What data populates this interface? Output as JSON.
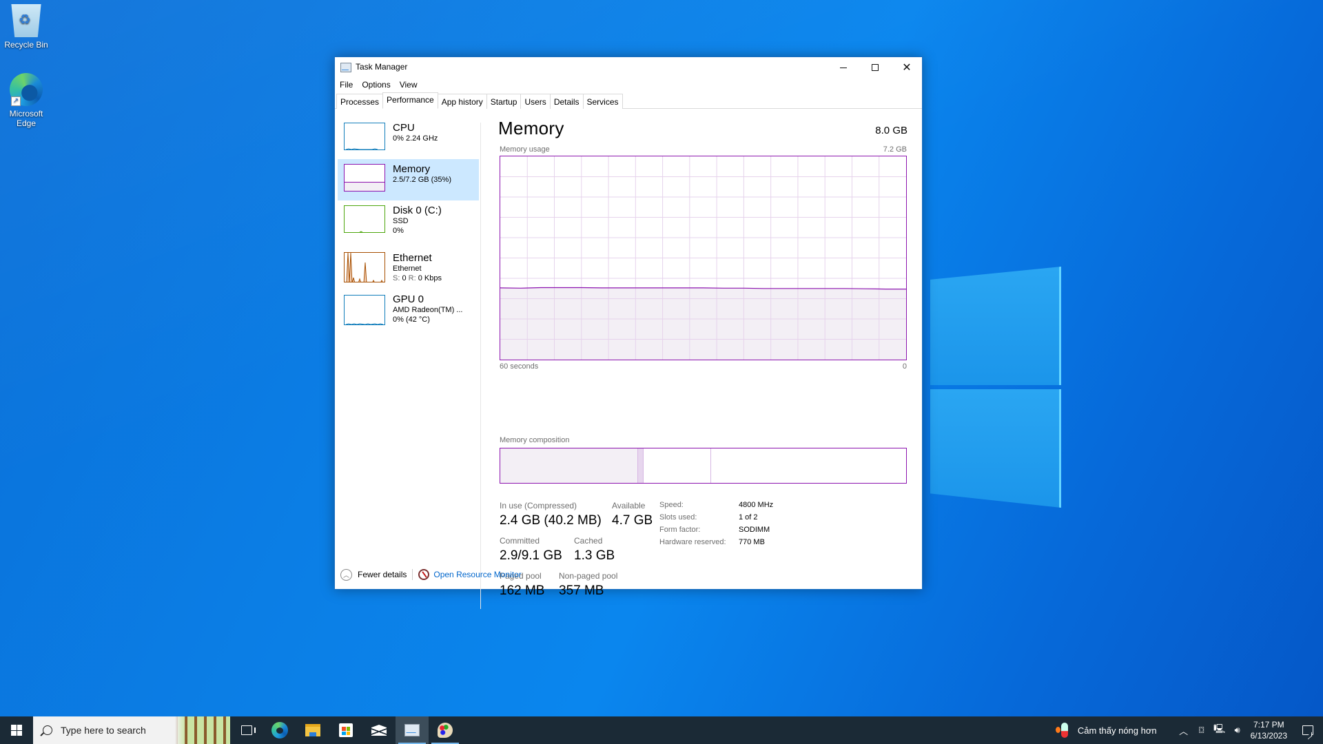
{
  "desktop": {
    "icons": [
      {
        "label": "Recycle Bin"
      },
      {
        "label": "Microsoft Edge"
      }
    ]
  },
  "window": {
    "title": "Task Manager",
    "controls": {
      "minimize": "minimize",
      "maximize": "maximize",
      "close": "close"
    },
    "menu": [
      "File",
      "Options",
      "View"
    ],
    "tabs": [
      {
        "label": "Processes",
        "active": false
      },
      {
        "label": "Performance",
        "active": true
      },
      {
        "label": "App history",
        "active": false
      },
      {
        "label": "Startup",
        "active": false
      },
      {
        "label": "Users",
        "active": false
      },
      {
        "label": "Details",
        "active": false
      },
      {
        "label": "Services",
        "active": false
      }
    ]
  },
  "sidebar": {
    "items": [
      {
        "name": "CPU",
        "line1": "0% 2.24 GHz",
        "line2": "",
        "color": "#117dbb",
        "selected": false
      },
      {
        "name": "Memory",
        "line1": "2.5/7.2 GB (35%)",
        "line2": "",
        "color": "#8b12ae",
        "selected": true,
        "usage_fraction": 0.35
      },
      {
        "name": "Disk 0 (C:)",
        "line1": "SSD",
        "line2": "0%",
        "color": "#4da60c",
        "selected": false
      },
      {
        "name": "Ethernet",
        "line1": "Ethernet",
        "line2_s_label": "S:",
        "line2_s_value": "0",
        "line2_r_label": "R:",
        "line2_r_value": "0 Kbps",
        "color": "#a74f01",
        "selected": false
      },
      {
        "name": "GPU 0",
        "line1": "AMD Radeon(TM) ...",
        "line2": "0% (42 °C)",
        "color": "#117dbb",
        "selected": false
      }
    ]
  },
  "detail": {
    "title": "Memory",
    "total": "8.0 GB",
    "graph": {
      "label": "Memory usage",
      "max_label": "7.2 GB",
      "x_left_label": "60 seconds",
      "x_right_label": "0",
      "accent": "#8b12ae",
      "fill": "#f3eff5",
      "grid": "#e6d3ec"
    },
    "composition": {
      "label": "Memory composition",
      "segments": [
        {
          "name": "in-use",
          "fraction": 0.34,
          "color": "#f3eff5"
        },
        {
          "name": "modified",
          "fraction": 0.013,
          "color": "#e7d6ee"
        },
        {
          "name": "standby",
          "fraction": 0.166,
          "color": "#ffffff"
        },
        {
          "name": "free",
          "fraction": 0.481,
          "color": "#ffffff"
        }
      ]
    },
    "stats": {
      "in_use_label": "In use (Compressed)",
      "in_use_value": "2.4 GB (40.2 MB)",
      "available_label": "Available",
      "available_value": "4.7 GB",
      "committed_label": "Committed",
      "committed_value": "2.9/9.1 GB",
      "cached_label": "Cached",
      "cached_value": "1.3 GB",
      "paged_label": "Paged pool",
      "paged_value": "162 MB",
      "nonpaged_label": "Non-paged pool",
      "nonpaged_value": "357 MB"
    },
    "specs": [
      {
        "label": "Speed:",
        "value": "4800 MHz"
      },
      {
        "label": "Slots used:",
        "value": "1 of 2"
      },
      {
        "label": "Form factor:",
        "value": "SODIMM"
      },
      {
        "label": "Hardware reserved:",
        "value": "770 MB"
      }
    ]
  },
  "footer": {
    "fewer_details": "Fewer details",
    "open_resmon": "Open Resource Monitor"
  },
  "taskbar": {
    "search_placeholder": "Type here to search",
    "weather_text": "Cảm thấy nóng hơn",
    "time": "7:17 PM",
    "date": "6/13/2023"
  },
  "chart_data": {
    "type": "area",
    "title": "Memory usage",
    "xlabel": "",
    "ylabel": "",
    "x_range_seconds": [
      60,
      0
    ],
    "ylim": [
      0,
      7.2
    ],
    "y_unit": "GB",
    "x": [
      60,
      57,
      54,
      51,
      48,
      45,
      42,
      39,
      36,
      33,
      30,
      27,
      24,
      21,
      18,
      15,
      12,
      9,
      6,
      3,
      0
    ],
    "values": [
      2.54,
      2.53,
      2.55,
      2.55,
      2.55,
      2.54,
      2.54,
      2.54,
      2.54,
      2.54,
      2.54,
      2.53,
      2.53,
      2.52,
      2.52,
      2.52,
      2.52,
      2.52,
      2.51,
      2.5,
      2.5
    ],
    "grid": true,
    "grid_columns": 15,
    "grid_rows": 10
  }
}
